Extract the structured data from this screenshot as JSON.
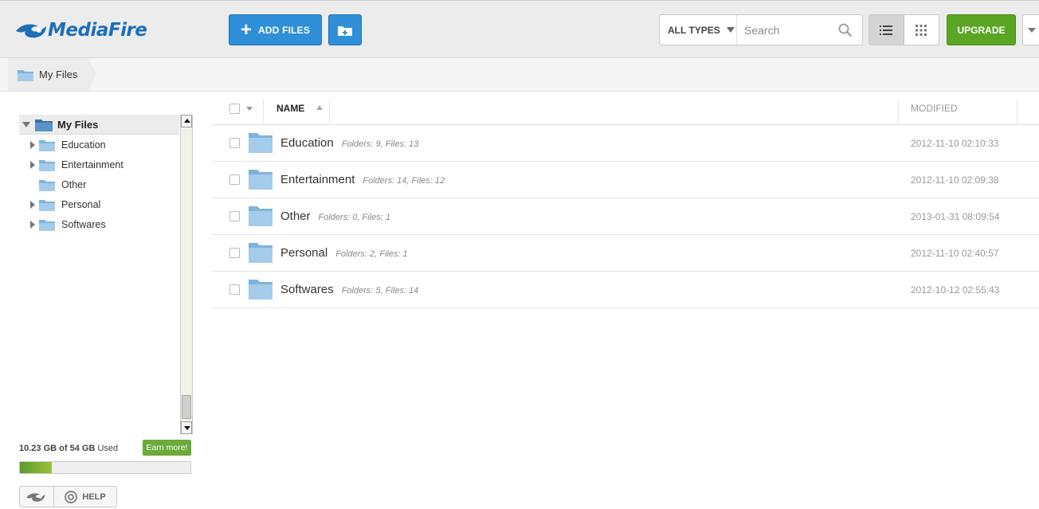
{
  "header": {
    "logo_text": "MediaFire",
    "add_files_label": "ADD FILES",
    "type_filter": "ALL TYPES",
    "search_placeholder": "Search",
    "upgrade_label": "UPGRADE"
  },
  "breadcrumb": {
    "current": "My Files"
  },
  "sidebar": {
    "root_label": "My Files",
    "items": [
      {
        "label": "Education",
        "expandable": true
      },
      {
        "label": "Entertainment",
        "expandable": true
      },
      {
        "label": "Other",
        "expandable": false
      },
      {
        "label": "Personal",
        "expandable": true
      },
      {
        "label": "Softwares",
        "expandable": true
      }
    ],
    "storage": {
      "used": "10.23 GB of 54 GB",
      "suffix": "Used",
      "fraction_used": 0.189,
      "earn_label": "Earn more!"
    },
    "help_label": "HELP"
  },
  "list": {
    "headers": {
      "name": "NAME",
      "modified": "MODIFIED"
    },
    "rows": [
      {
        "name": "Education",
        "meta": "Folders: 9, Files: 13",
        "modified": "2012-11-10 02:10:33"
      },
      {
        "name": "Entertainment",
        "meta": "Folders: 14, Files: 12",
        "modified": "2012-11-10 02:09:38"
      },
      {
        "name": "Other",
        "meta": "Folders: 0, Files: 1",
        "modified": "2013-01-31 08:09:54"
      },
      {
        "name": "Personal",
        "meta": "Folders: 2, Files: 1",
        "modified": "2012-11-10 02:40:57"
      },
      {
        "name": "Softwares",
        "meta": "Folders: 5, Files: 14",
        "modified": "2012-10-12 02:55:43"
      }
    ]
  },
  "colors": {
    "accent_blue": "#2f8fd8",
    "upgrade_green": "#5aa523",
    "folder_blue": "#8fc1e6"
  }
}
